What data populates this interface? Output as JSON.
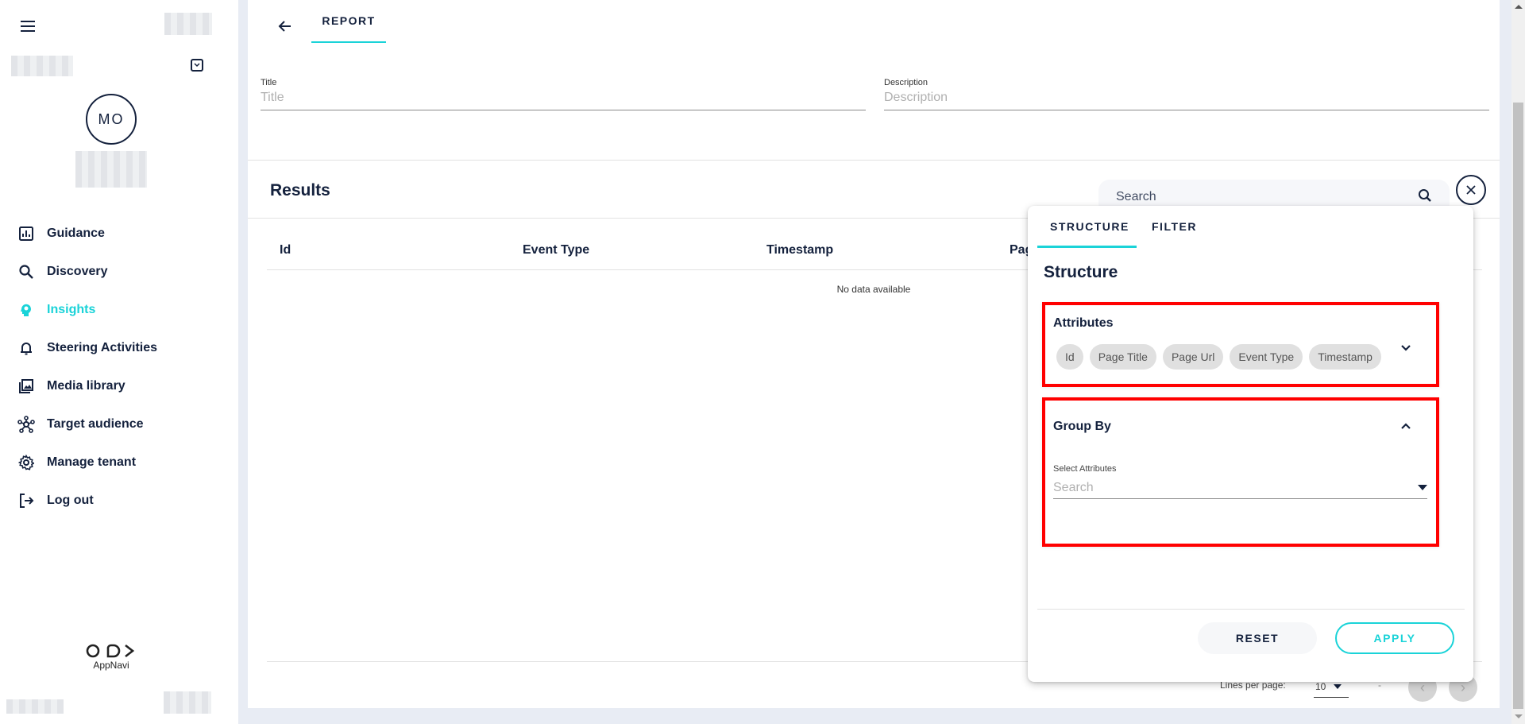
{
  "colors": {
    "accent": "#1ad3d8",
    "text_dark": "#14213d",
    "highlight_box": "#ff0000",
    "background": "#e8ecf4"
  },
  "sidebar": {
    "menu_icon": "hamburger-icon",
    "tenant_toggle_icon": "chevron-down-square-icon",
    "avatar_initials": "MO",
    "items": [
      {
        "label": "Guidance",
        "icon": "bar-chart-icon",
        "active": false
      },
      {
        "label": "Discovery",
        "icon": "search-icon",
        "active": false
      },
      {
        "label": "Insights",
        "icon": "head-lightbulb-icon",
        "active": true
      },
      {
        "label": "Steering Activities",
        "icon": "bell-icon",
        "active": false
      },
      {
        "label": "Media library",
        "icon": "image-library-icon",
        "active": false
      },
      {
        "label": "Target audience",
        "icon": "network-icon",
        "active": false
      },
      {
        "label": "Manage tenant",
        "icon": "gear-icon",
        "active": false
      },
      {
        "label": "Log out",
        "icon": "logout-icon",
        "active": false
      }
    ],
    "logo_text": "AppNavi"
  },
  "header": {
    "back_icon": "arrow-left-icon",
    "tab_label": "REPORT"
  },
  "form": {
    "title_label": "Title",
    "title_placeholder": "Title",
    "title_value": "",
    "description_label": "Description",
    "description_placeholder": "Description",
    "description_value": ""
  },
  "results": {
    "title": "Results",
    "search_placeholder": "Search",
    "columns": [
      "Id",
      "Event Type",
      "Timestamp",
      "Pag"
    ],
    "empty_text": "No data available",
    "pagination": {
      "lines_label": "Lines per page:",
      "lines_value": "10",
      "range_text": "-",
      "prev_icon": "‹",
      "next_icon": "›"
    }
  },
  "panel": {
    "tabs": [
      {
        "label": "STRUCTURE",
        "active": true
      },
      {
        "label": "FILTER",
        "active": false
      }
    ],
    "title": "Structure",
    "attributes": {
      "title": "Attributes",
      "chips": [
        "Id",
        "Page Title",
        "Page Url",
        "Event Type",
        "Timestamp"
      ],
      "expanded": false
    },
    "group_by": {
      "title": "Group By",
      "expanded": true,
      "select_label": "Select Attributes",
      "select_placeholder": "Search",
      "select_value": ""
    },
    "reset_label": "RESET",
    "apply_label": "APPLY"
  }
}
